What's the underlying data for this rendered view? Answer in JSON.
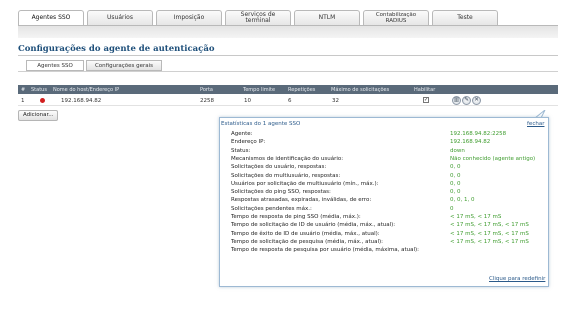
{
  "top_tabs": [
    "Agentes SSO",
    "Usuários",
    "Imposição",
    "Serviços de terminal",
    "NTLM",
    "Contabilização RADIUS",
    "Teste"
  ],
  "section_title": "Configurações do agente de autenticação",
  "sub_tabs": [
    "Agentes SSO",
    "Configurações gerais"
  ],
  "grid": {
    "headers": [
      "#",
      "Status",
      "Nome do host/Endereço IP",
      "Porta",
      "Tempo limite",
      "Repetições",
      "Máximo de solicitações",
      "Habilitar"
    ],
    "row": {
      "index": "1",
      "status_color": "#d21f1f",
      "host": "192.168.94.82",
      "port": "2258",
      "timeout": "10",
      "retries": "6",
      "max_requests": "32",
      "enabled": true
    }
  },
  "add_button": "Adicionar...",
  "popup": {
    "title": "Estatísticas do 1 agente SSO",
    "close": "fechar",
    "reset": "Clique para redefinir",
    "stats": [
      {
        "label": "Agente:",
        "value": "192.168.94.82:2258"
      },
      {
        "label": "Endereço IP:",
        "value": "192.168.94.82"
      },
      {
        "label": "Status:",
        "value": "down"
      },
      {
        "label": "Mecanismos de identificação do usuário:",
        "value": "Não conhecido (agente antigo)"
      },
      {
        "label": "Solicitações do usuário, respostas:",
        "value": "0, 0"
      },
      {
        "label": "Solicitações do multiusuário, respostas:",
        "value": "0, 0"
      },
      {
        "label": "Usuários por solicitação de multiusuário (mín., máx.):",
        "value": "0, 0"
      },
      {
        "label": "Solicitações do ping SSO, respostas:",
        "value": "0, 0"
      },
      {
        "label": "Respostas atrasadas, expiradas, inválidas, de erro:",
        "value": "0, 0, 1, 0"
      },
      {
        "label": "Solicitações pendentes máx.:",
        "value": "0"
      },
      {
        "label": "Tempo de resposta de ping SSO (média, máx.):",
        "value": "< 17 mS, < 17 mS"
      },
      {
        "label": "Tempo de solicitação de ID de usuário (média, máx., atual):",
        "value": "< 17 mS, < 17 mS, < 17 mS"
      },
      {
        "label": "Tempo de êxito de ID de usuário (média, máx., atual):",
        "value": "< 17 mS, < 17 mS, < 17 mS"
      },
      {
        "label": "Tempo de solicitação de pesquisa (média, máx., atual):",
        "value": "< 17 mS, < 17 mS, < 17 mS"
      },
      {
        "label": "Tempo de resposta de pesquisa por usuário (média, máxima, atual):",
        "value": ""
      }
    ]
  },
  "colors": {
    "accent": "#1e4f7a",
    "value_green": "#3c9b2c",
    "link": "#2b5a8a"
  }
}
